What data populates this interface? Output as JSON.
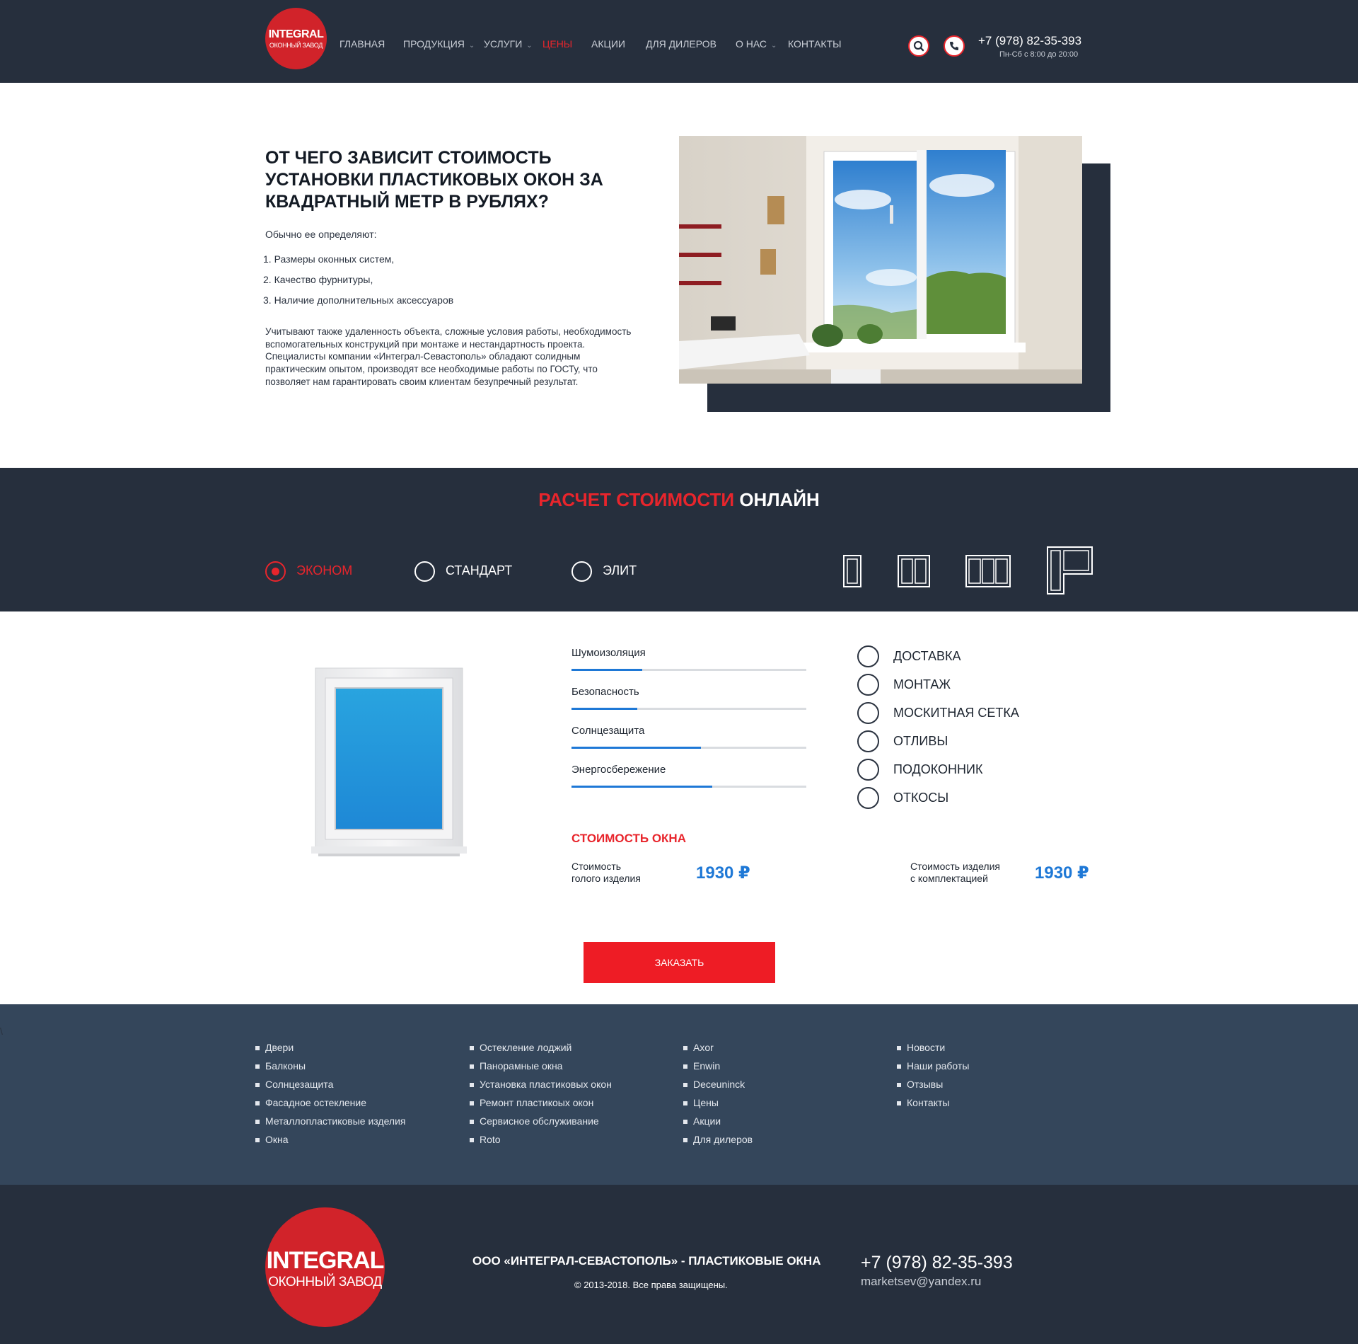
{
  "header": {
    "logo": {
      "title": "INTEGRAL",
      "subtitle": "ОКОННЫЙ ЗАВОД"
    },
    "nav": [
      {
        "label": "ГЛАВНАЯ"
      },
      {
        "label": "ПРОДУКЦИЯ"
      },
      {
        "label": "УСЛУГИ"
      },
      {
        "label": "ЦЕНЫ",
        "active": true
      },
      {
        "label": "АКЦИИ"
      },
      {
        "label": "ДЛЯ ДИЛЕРОВ"
      },
      {
        "label": "О НАС"
      },
      {
        "label": "КОНТАКТЫ"
      }
    ],
    "dropdown_icon": "chevron-down-icon",
    "search_icon": "search-icon",
    "phone_icon": "phone-icon",
    "phone": "+7 (978) 82-35-393",
    "hours": "Пн-Сб с 8:00 до 20:00"
  },
  "intro": {
    "title": "ОТ ЧЕГО ЗАВИСИТ СТОИМОСТЬ УСТАНОВКИ ПЛАСТИКОВЫХ ОКОН ЗА КВАДРАТНЫЙ МЕТР В РУБЛЯХ?",
    "lead": "Обычно ее определяют:",
    "list": [
      "1. Размеры оконных систем,",
      "2. Качество фурнитуры,",
      "3. Наличие дополнительных аксессуаров"
    ],
    "body": "Учитывают также удаленность объекта, сложные условия работы, необходимость вспомогательных конструкций при монтаже и нестандартность проекта. Специалисты компании «Интеграл-Севастополь» обладают солидным практическим опытом, производят все необходимые работы по ГОСТу, что позволяет нам гарантировать своим клиентам безупречный результат."
  },
  "calculator": {
    "title_accent": "РАСЧЕТ СТОИМОСТИ",
    "title_rest": "ОНЛАЙН",
    "classes": [
      {
        "label": "ЭКОНОМ",
        "selected": true
      },
      {
        "label": "СТАНДАРТ",
        "selected": false
      },
      {
        "label": "ЭЛИТ",
        "selected": false
      }
    ],
    "window_types": [
      "single-sash-window-icon",
      "double-sash-window-icon",
      "triple-sash-window-icon",
      "balcony-door-icon"
    ],
    "properties": [
      {
        "label": "Шумоизоляция",
        "level": 0.3
      },
      {
        "label": "Безопасность",
        "level": 0.28
      },
      {
        "label": "Солнцезащита",
        "level": 0.55
      },
      {
        "label": "Энергосбережение",
        "level": 0.6
      }
    ],
    "extras": [
      {
        "label": "ДОСТАВКА",
        "checked": false
      },
      {
        "label": "МОНТАЖ",
        "checked": false
      },
      {
        "label": "МОСКИТНАЯ СЕТКА",
        "checked": false
      },
      {
        "label": "ОТЛИВЫ",
        "checked": false
      },
      {
        "label": "ПОДОКОННИК",
        "checked": false
      },
      {
        "label": "ОТКОСЫ",
        "checked": false
      }
    ],
    "cost_title": "СТОИМОСТЬ ОКНА",
    "bare_label_1": "Стоимость",
    "bare_label_2": "голого изделия",
    "bare_value": "1930 ₽",
    "full_label_1": "Стоимость изделия",
    "full_label_2": "с комплектацией",
    "full_value": "1930 ₽",
    "order_button": "ЗАКАЗАТЬ"
  },
  "footer_links": {
    "stray_char": "\\",
    "columns": [
      [
        "Двери",
        "Балконы",
        "Солнцезащита",
        "Фасадное остекление",
        "Металлопластиковые изделия",
        "Окна"
      ],
      [
        "Остекление лоджий",
        "Панорамные окна",
        "Установка пластиковых окон",
        "Ремонт пластикоых окон",
        "Сервисное обслуживание",
        "Roto"
      ],
      [
        "Axor",
        "Enwin",
        "Deceuninck",
        "Цены",
        "Акции",
        "Для дилеров"
      ],
      [
        "Новости",
        "Наши работы",
        "Отзывы",
        "Контакты"
      ]
    ]
  },
  "footer": {
    "logo": {
      "title": "INTEGRAL",
      "subtitle": "ОКОННЫЙ ЗАВОД"
    },
    "company": "ООО «ИНТЕГРАЛ-СЕВАСТОПОЛЬ» - ПЛАСТИКОВЫЕ ОКНА",
    "copyright": "© 2013-2018. Все права защищены.",
    "phone": "+7 (978) 82-35-393",
    "email": "marketsev@yandex.ru"
  },
  "colors": {
    "dark": "#262f3d",
    "footer_links_bg": "#34465b",
    "accent_red": "#e8252c",
    "accent_blue": "#1e78d6"
  }
}
